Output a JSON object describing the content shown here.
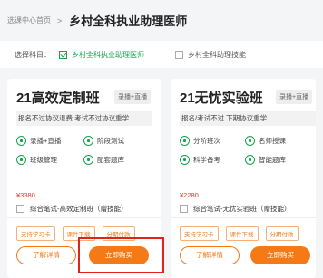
{
  "breadcrumb": {
    "home": "选课中心首页",
    "separator": ">",
    "title": "乡村全科执业助理医师"
  },
  "filter": {
    "label": "选择科目：",
    "options": [
      {
        "label": "乡村全科执业助理医师",
        "checked": true
      },
      {
        "label": "乡村全科助理技能",
        "checked": false
      }
    ]
  },
  "cards": [
    {
      "name": "21高效定制班",
      "tag": "录播+直播",
      "desc": "报名不过协议退费 考试不过协议重学",
      "features": [
        "录播+直播",
        "阶段测试",
        "班级管理",
        "配套题库"
      ],
      "price": "¥3380",
      "combo": "综合笔试-高效定制班（赠技能）",
      "badges": [
        "支持学习卡",
        "课件下载",
        "分期付款"
      ],
      "detail": "了解详情",
      "buy": "立即购买"
    },
    {
      "name": "21无忧实验班",
      "tag": "录播+直播",
      "desc": "报名/考试不过 下期协议重学",
      "features": [
        "分阶班次",
        "名师授课",
        "科学备考",
        "智能题库"
      ],
      "price": "¥2280",
      "combo": "综合笔试-无忧实验班（赠技能）",
      "badges": [
        "支持学习卡",
        "课件下载",
        "分期付款"
      ],
      "detail": "了解详情",
      "buy": "立即购买"
    }
  ],
  "colors": {
    "accent": "#f57a16",
    "brand_green": "#19a14c",
    "price_red": "#e03a2e",
    "highlight": "#e3231b"
  }
}
